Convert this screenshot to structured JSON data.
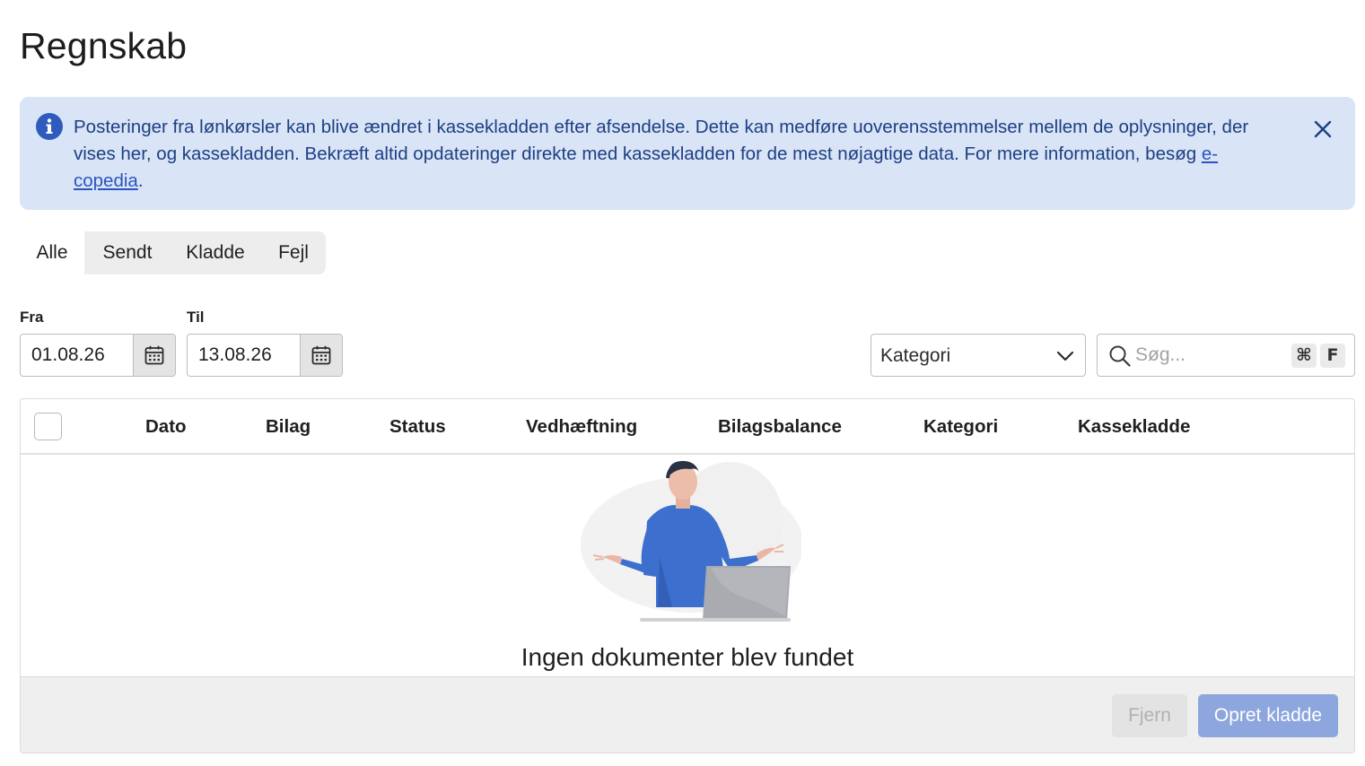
{
  "page": {
    "title": "Regnskab"
  },
  "banner": {
    "text_prefix": "Posteringer fra lønkørsler kan blive ændret i kassekladden efter afsendelse. Dette kan medføre uoverensstemmelser mellem de oplysninger, der vises her, og kassekladden. Bekræft altid opdateringer direkte med kassekladden for de mest nøjagtige data. For mere information, besøg ",
    "link_text": "e-copedia",
    "text_suffix": ".",
    "icon": "info-icon",
    "close_icon": "close-icon",
    "color": "#d9e4f6"
  },
  "tabs": [
    {
      "label": "Alle",
      "active": true
    },
    {
      "label": "Sendt",
      "active": false
    },
    {
      "label": "Kladde",
      "active": false
    },
    {
      "label": "Fejl",
      "active": false
    }
  ],
  "filters": {
    "from_label": "Fra",
    "from_value": "01.08.26",
    "to_label": "Til",
    "to_value": "13.08.26",
    "category_label": "Kategori",
    "search_placeholder": "Søg...",
    "shortcut_keys": [
      "⌘",
      "F"
    ]
  },
  "table": {
    "columns": [
      "Dato",
      "Bilag",
      "Status",
      "Vedhæftning",
      "Bilagsbalance",
      "Kategori",
      "Kassekladde"
    ],
    "empty_message": "Ingen dokumenter blev fundet"
  },
  "footer": {
    "remove_label": "Fjern",
    "create_label": "Opret kladde",
    "accent": "#8da6dd"
  }
}
